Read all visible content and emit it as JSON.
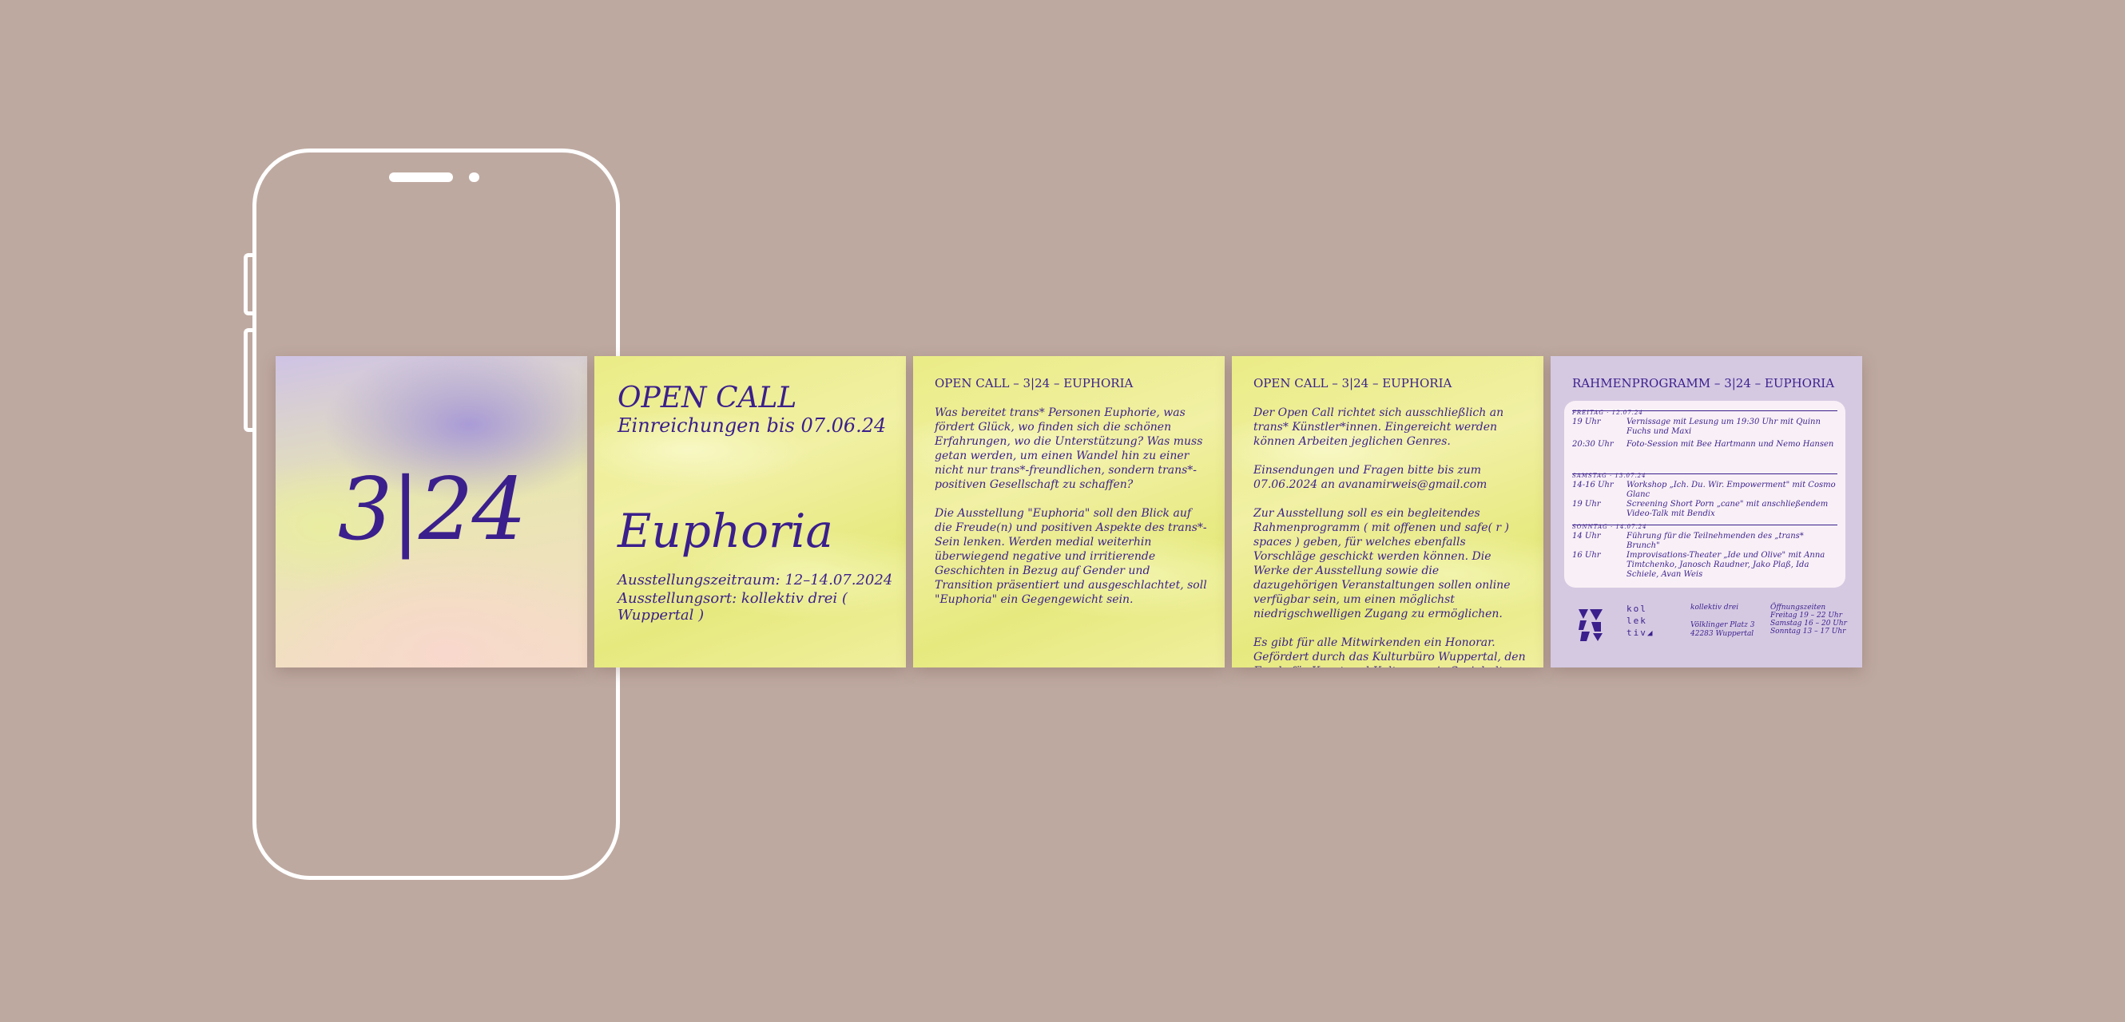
{
  "panel1": {
    "number": "3|24"
  },
  "panel2": {
    "title": "OPEN CALL",
    "deadline": "Einreichungen bis 07.06.24",
    "name": "Euphoria",
    "period": "Ausstellungszeitraum: 12–14.07.2024",
    "location": "Ausstellungsort: kollektiv drei ( Wuppertal )"
  },
  "panel3": {
    "header": "OPEN CALL – 3|24 – EUPHORIA",
    "paragraphs": [
      "Was bereitet trans* Personen Euphorie, was fördert Glück, wo finden sich die schönen Erfahrungen, wo die Unterstützung? Was muss getan werden, um einen Wandel hin zu einer nicht nur trans*-freundlichen, sondern trans*-positiven Gesellschaft zu schaffen?",
      "Die Ausstellung \"Euphoria\" soll den Blick auf die Freude(n) und positiven Aspekte des trans*-Sein lenken. Werden medial weiterhin überwiegend negative und irritierende Geschichten in Bezug auf Gender und Transition präsentiert und ausgeschlachtet, soll \"Euphoria\" ein Gegengewicht sein."
    ]
  },
  "panel4": {
    "header": "OPEN CALL – 3|24 – EUPHORIA",
    "paragraphs": [
      "Der Open Call richtet sich ausschließlich an trans* Künstler*innen. Eingereicht werden können Arbeiten jeglichen Genres.",
      "Einsendungen und Fragen bitte bis zum 07.06.2024 an avanamirweis@gmail.com",
      "Zur Ausstellung soll es ein begleitendes Rahmenprogramm ( mit offenen und safe( r ) spaces ) geben, für welches ebenfalls Vorschläge geschickt werden können. Die Werke der Ausstellung sowie die dazugehörigen Veranstaltungen sollen online verfügbar sein, um einen möglichst niedrigschwelligen Zugang zu ermöglichen.",
      "Es gibt für alle Mitwirkenden ein Honorar. Gefördert durch das Kulturbüro Wuppertal, den Fonds für Kunst und Kultur, sowie Soziokultur NRW."
    ]
  },
  "panel5": {
    "header": "RAHMENPROGRAMM – 3|24 – EUPHORIA",
    "days": [
      {
        "name": "FREITAG · 12.07.24",
        "events": [
          {
            "time": "19 Uhr",
            "desc": "Vernissage mit Lesung um 19:30 Uhr mit Quinn Fuchs und Maxi"
          },
          {
            "time": "20:30 Uhr",
            "desc": "Foto-Session mit Bee Hartmann und Nemo Hansen"
          }
        ]
      },
      {
        "name": "SAMSTAG · 13.07.24",
        "events": [
          {
            "time": "14-16 Uhr",
            "desc": "Workshop „Ich. Du. Wir. Empowerment\" mit Cosmo Glanc"
          },
          {
            "time": "19 Uhr",
            "desc": "Screening Short Porn „cane\" mit anschließendem Video-Talk mit Bendix"
          }
        ]
      },
      {
        "name": "SONNTAG · 14.07.24",
        "events": [
          {
            "time": "14 Uhr",
            "desc": "Führung für die Teilnehmenden des „trans* Brunch\""
          },
          {
            "time": "16 Uhr",
            "desc": "Improvisations-Theater „Ide und Olive\" mit Anna Timtchenko, Janosch Raudner, Jako Plaß, Ida Schiele, Avan Weis"
          }
        ]
      }
    ],
    "logo_lines": [
      "kol",
      "lek",
      "tiv◢"
    ],
    "address": [
      "kollektiv drei",
      "",
      "Völklinger Platz 3",
      "42283 Wuppertal"
    ],
    "hours": [
      "Öffnungszeiten",
      "Freitag 19 – 22 Uhr",
      "Samstag 16 – 20 Uhr",
      "Sonntag 13 – 17 Uhr"
    ]
  },
  "colors": {
    "background": "#bea9a0",
    "ink": "#3b1f8c",
    "yellow": "#eaec86",
    "lilac": "#d5c9e2"
  }
}
